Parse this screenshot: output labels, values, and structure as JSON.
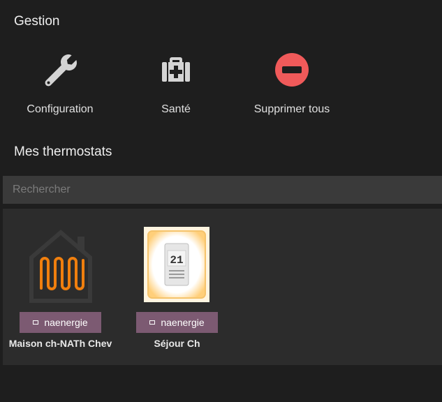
{
  "gestion": {
    "title": "Gestion",
    "actions": [
      {
        "label": "Configuration",
        "icon": "wrench-icon"
      },
      {
        "label": "Santé",
        "icon": "medical-kit-icon"
      },
      {
        "label": "Supprimer tous",
        "icon": "minus-circle-icon"
      }
    ]
  },
  "thermostats": {
    "title": "Mes thermostats",
    "search": {
      "placeholder": "Rechercher",
      "value": ""
    },
    "items": [
      {
        "name": "Maison ch-NATh Chev",
        "tag": "naenergie",
        "icon": "house-heating-icon"
      },
      {
        "name": "Séjour Ch",
        "tag": "naenergie",
        "icon": "thermostat-device-image",
        "display_value": "21"
      }
    ]
  },
  "colors": {
    "background": "#1e1e1e",
    "panel": "#2c2c2c",
    "search_bg": "#3a3a3a",
    "badge": "#7c5a72",
    "danger": "#f05a5a",
    "icon_grey": "#d4d4d4",
    "heating_orange": "#f07f0e"
  }
}
